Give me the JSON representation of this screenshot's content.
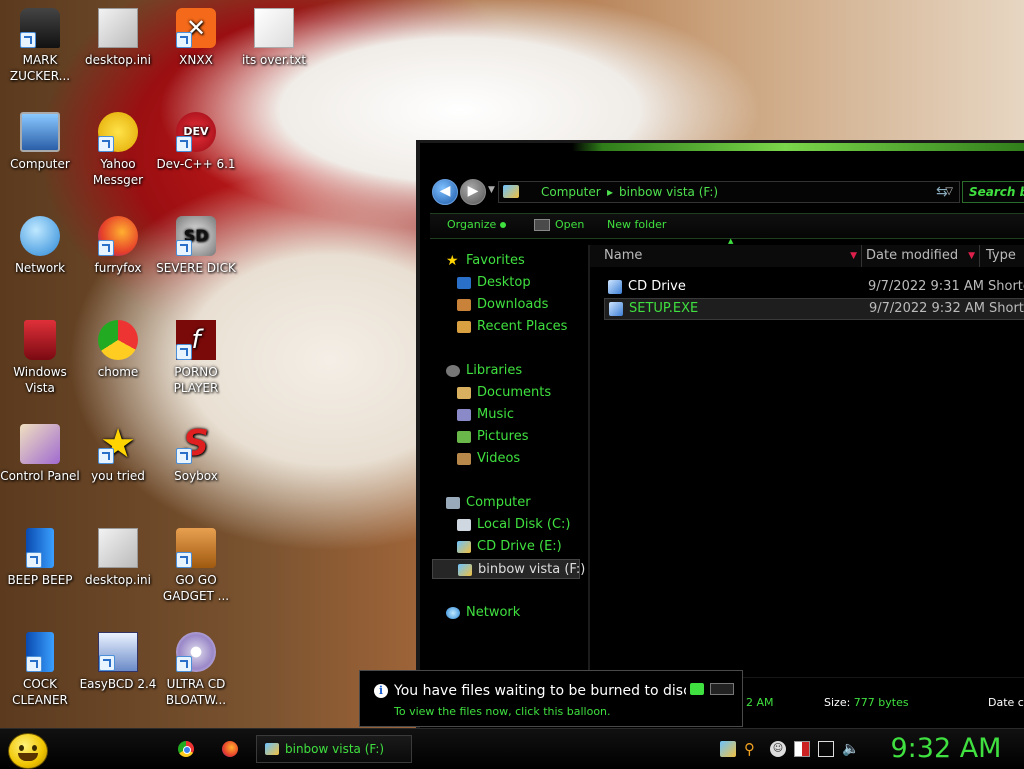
{
  "desktop": {
    "icons": [
      {
        "label": "MARK ZUCKER..."
      },
      {
        "label": "desktop.ini"
      },
      {
        "label": "XNXX"
      },
      {
        "label": "its over.txt"
      },
      {
        "label": "Computer"
      },
      {
        "label": "Yahoo Messger"
      },
      {
        "label": "Dev-C++ 6.1"
      },
      {
        "label": "Network"
      },
      {
        "label": "furryfox"
      },
      {
        "label": "SEVERE DICK"
      },
      {
        "label": "Windows Vista"
      },
      {
        "label": "chome"
      },
      {
        "label": "PORNO PLAYER"
      },
      {
        "label": "Control Panel"
      },
      {
        "label": "you tried"
      },
      {
        "label": "Soybox"
      },
      {
        "label": "BEEP BEEP"
      },
      {
        "label": "desktop.ini"
      },
      {
        "label": "GO GO GADGET ..."
      },
      {
        "label": "COCK CLEANER"
      },
      {
        "label": "EasyBCD 2.4"
      },
      {
        "label": "ULTRA CD BLOATW..."
      }
    ]
  },
  "explorer": {
    "address": {
      "segment1": "Computer",
      "segment2": "binbow vista (F:)"
    },
    "search_placeholder": "Search bin",
    "commands": {
      "organize": "Organize",
      "open": "Open",
      "new_folder": "New folder"
    },
    "nav": {
      "favorites": "Favorites",
      "desktop": "Desktop",
      "downloads": "Downloads",
      "recent": "Recent Places",
      "libraries": "Libraries",
      "documents": "Documents",
      "music": "Music",
      "pictures": "Pictures",
      "videos": "Videos",
      "computer": "Computer",
      "local_disk": "Local Disk (C:)",
      "cd_drive": "CD Drive (E:)",
      "binbow": "binbow vista (F:)",
      "network": "Network"
    },
    "columns": {
      "name": "Name",
      "date": "Date modified",
      "type": "Type"
    },
    "files": [
      {
        "name": "CD Drive",
        "date": "9/7/2022 9:31 AM",
        "type": "Shortcut"
      },
      {
        "name": "SETUP.EXE",
        "date": "9/7/2022 9:32 AM",
        "type": "Shortcut"
      }
    ],
    "details": {
      "date_fragment": "2 AM",
      "size_label": "Size:",
      "size_value": "777 bytes",
      "date_created_label": "Date created"
    }
  },
  "balloon": {
    "title": "You have files waiting to be burned to disc",
    "subtitle": "To view the files now, click this balloon."
  },
  "taskbar": {
    "task_label": "binbow vista (F:)",
    "clock": "9:32 AM"
  },
  "colors": {
    "accent_green": "#3fe03f",
    "window_bg": "#000000"
  }
}
